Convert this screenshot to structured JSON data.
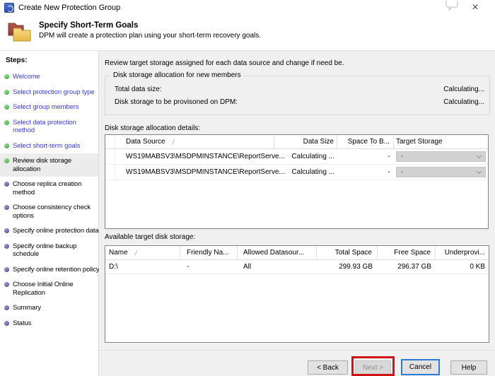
{
  "window": {
    "title": "Create New Protection Group",
    "close": "×"
  },
  "header": {
    "title": "Specify Short-Term Goals",
    "subtitle": "DPM will create a protection plan using your short-term recovery goals."
  },
  "sidebar": {
    "heading": "Steps:",
    "items": [
      {
        "label": "Welcome",
        "state": "done"
      },
      {
        "label": "Select protection group type",
        "state": "done"
      },
      {
        "label": "Select group members",
        "state": "done"
      },
      {
        "label": "Select data protection\nmethod",
        "state": "done"
      },
      {
        "label": "Select short-term goals",
        "state": "done"
      },
      {
        "label": "Review disk storage\nallocation",
        "state": "current"
      },
      {
        "label": "Choose replica creation\nmethod",
        "state": "todo"
      },
      {
        "label": "Choose consistency check\noptions",
        "state": "todo"
      },
      {
        "label": "Specify online protection data",
        "state": "todo"
      },
      {
        "label": "Specify online backup\nschedule",
        "state": "todo"
      },
      {
        "label": "Specify online retention policy",
        "state": "todo"
      },
      {
        "label": "Choose Initial Online\nReplication",
        "state": "todo"
      },
      {
        "label": "Summary",
        "state": "todo"
      },
      {
        "label": "Status",
        "state": "todo"
      }
    ]
  },
  "main": {
    "intro": "Review target storage assigned for each data source and change if need be.",
    "allocation_group": {
      "legend": "Disk storage allocation for new members",
      "rows": [
        {
          "label": "Total data size:",
          "value": "Calculating..."
        },
        {
          "label": "Disk storage to be provisoned on DPM:",
          "value": "Calculating..."
        }
      ]
    },
    "details_label": "Disk storage allocation details:",
    "details_table": {
      "columns": [
        "Data Source",
        "Data Size",
        "Space To B...",
        "Target Storage"
      ],
      "rows": [
        {
          "data_source": "WS19MABSV3\\MSDPMINSTANCE\\ReportServe...",
          "data_size": "Calculating ...",
          "space_to_be": "-",
          "target_storage": "-"
        },
        {
          "data_source": "WS19MABSV3\\MSDPMINSTANCE\\ReportServe...",
          "data_size": "Calculating ...",
          "space_to_be": "-",
          "target_storage": "-"
        }
      ]
    },
    "available_label": "Available target disk storage:",
    "available_table": {
      "columns": [
        "Name",
        "Friendly Na...",
        "Allowed Datasour...",
        "Total Space",
        "Free Space",
        "Underprovi..."
      ],
      "rows": [
        {
          "name": "D:\\",
          "friendly_name": "-",
          "allowed_datasources": "All",
          "total_space": "299.93 GB",
          "free_space": "296.37 GB",
          "underprovisioned": "0 KB"
        }
      ]
    }
  },
  "footer": {
    "back": "< Back",
    "next": "Next >",
    "cancel": "Cancel",
    "help": "Help"
  },
  "icons": {
    "sort_ascending": "/"
  },
  "colors": {
    "annotation_red": "#d21414",
    "focus_blue": "#2b7cd3",
    "link_blue": "#3a3ae0",
    "done_green": "#2fa42f",
    "todo_navy": "#44448c"
  }
}
